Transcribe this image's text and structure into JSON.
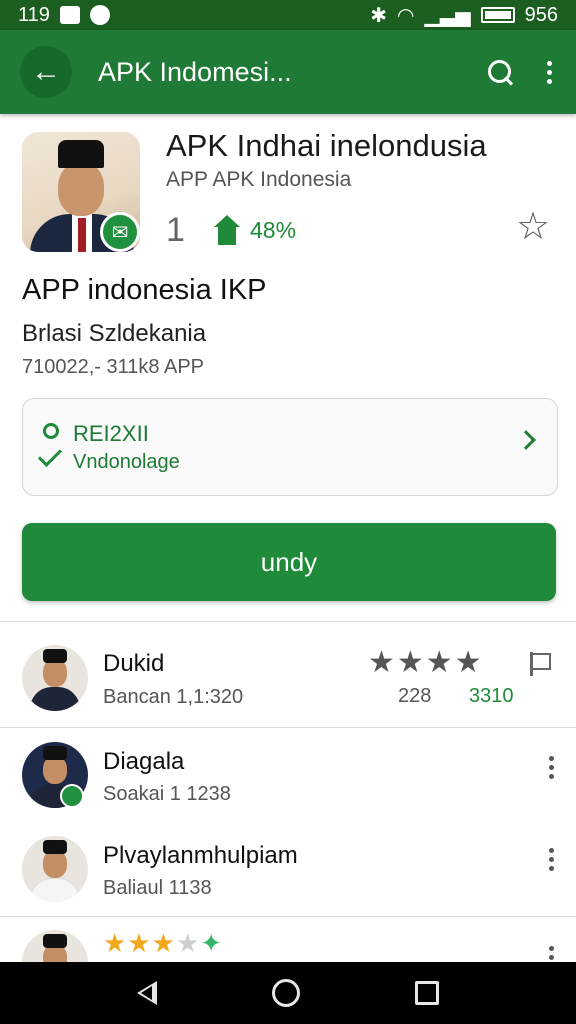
{
  "status_bar": {
    "left_text": "119",
    "right_text": "956"
  },
  "app_bar": {
    "title": "APK Indomesi..."
  },
  "app": {
    "title": "APK Indhai inelondusia",
    "developer": "APP APK Indonesia",
    "rating_number": "1",
    "percentage": "48%",
    "section_title": "APP indonesia IKP",
    "subtitle": "Brlasi Szldekania",
    "meta": "710022,- 311k8  APP"
  },
  "info_card": {
    "line1": "REI2XII",
    "line2": "Vndonolage"
  },
  "primary_button": {
    "label": "undy"
  },
  "list": [
    {
      "title": "Dukid",
      "subtitle": "Bancan 1,1:320",
      "stat_a": "228",
      "stat_b": "3310"
    },
    {
      "title": "Diagala",
      "subtitle": "Soakai 1 1238"
    },
    {
      "title": "Plvaylanmhulpiam",
      "subtitle": "Baliaul 1138"
    }
  ],
  "icons": {
    "back": "back-arrow-icon",
    "search": "search-icon",
    "more": "more-vert-icon",
    "star": "star-outline-icon",
    "flag": "flag-icon",
    "nav": [
      "nav-back-icon",
      "nav-home-icon",
      "nav-recents-icon"
    ]
  },
  "colors": {
    "primary": "#1e8a3a",
    "appbar": "#1e7a34",
    "statusbar": "#1b5e20",
    "star_gold": "#f2a81d"
  }
}
